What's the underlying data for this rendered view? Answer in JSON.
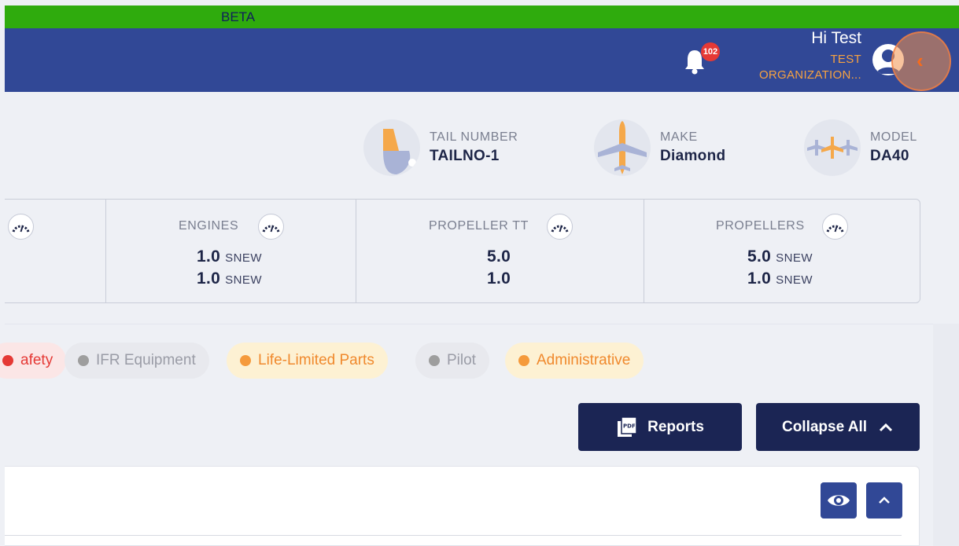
{
  "banner": {
    "label": "BETA"
  },
  "header": {
    "notifications_count": "102",
    "greeting": "Hi Test",
    "org_line1": "TEST",
    "org_line2": "ORGANIZATION..."
  },
  "aircraft": {
    "tail_label": "TAIL NUMBER",
    "tail_value": "TAILNO-1",
    "make_label": "MAKE",
    "make_value": "Diamond",
    "model_label": "MODEL",
    "model_value": "DA40"
  },
  "stats": {
    "engines": {
      "title": "ENGINES",
      "line1_value": "1.0",
      "line1_unit": "SNEW",
      "line2_value": "1.0",
      "line2_unit": "SNEW"
    },
    "propeller_tt": {
      "title": "PROPELLER TT",
      "line1_value": "5.0",
      "line2_value": "1.0"
    },
    "propellers": {
      "title": "PROPELLERS",
      "line1_value": "5.0",
      "line1_unit": "SNEW",
      "line2_value": "1.0",
      "line2_unit": "SNEW"
    }
  },
  "filters": [
    {
      "label": "afety",
      "color": "#e53935"
    },
    {
      "label": "IFR Equipment",
      "color": "#9e9e9e"
    },
    {
      "label": "Life-Limited Parts",
      "color": "#f59a3c"
    },
    {
      "label": "Pilot",
      "color": "#9e9e9e"
    },
    {
      "label": "Administrative",
      "color": "#f59a3c"
    }
  ],
  "actions": {
    "reports_label": "Reports",
    "collapse_label": "Collapse All"
  },
  "icons": {
    "bell": "bell-icon",
    "pdf": "pdf-icon",
    "chevron_up": "chevron-up-icon",
    "eye": "eye-icon",
    "gauge": "gauge-icon",
    "chevron_left": "chevron-left-icon"
  }
}
